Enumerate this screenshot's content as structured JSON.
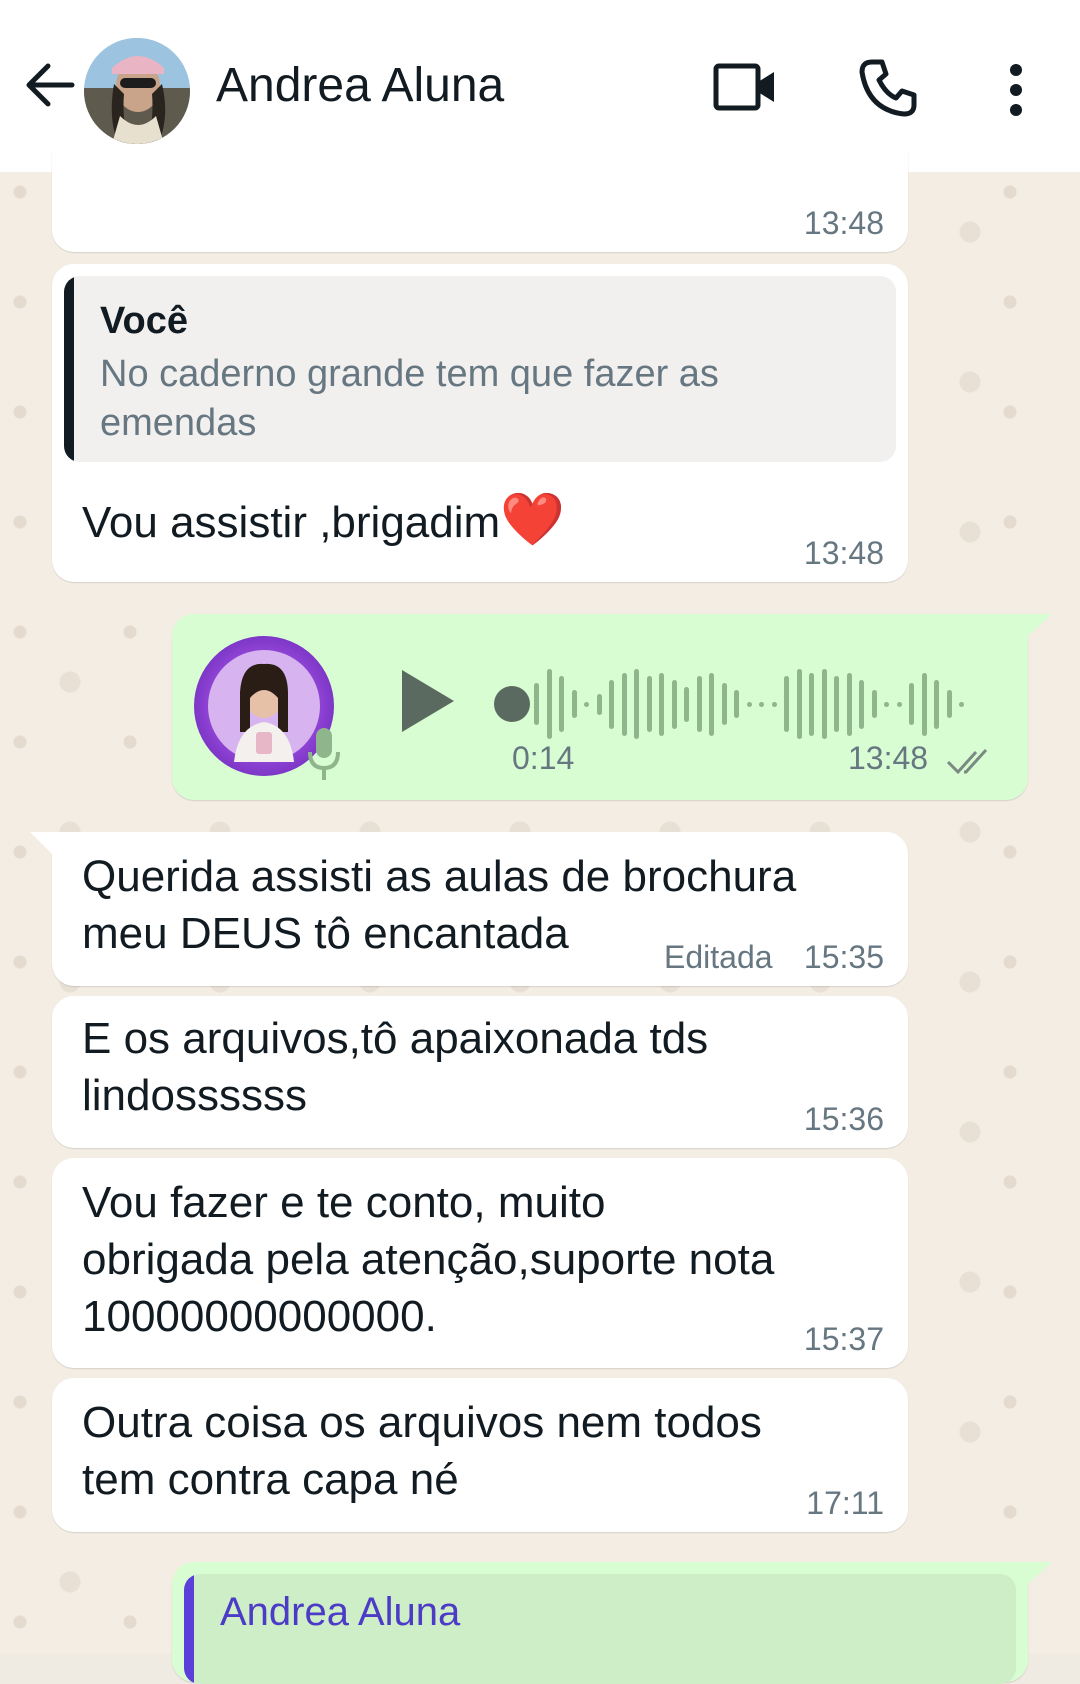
{
  "header": {
    "contact_name": "Andrea Aluna"
  },
  "icons": {
    "back": "arrow-left-icon",
    "video": "video-camera-icon",
    "call": "phone-icon",
    "menu": "more-vertical-icon",
    "mic": "microphone-icon",
    "play": "play-icon",
    "read_receipt": "double-check-icon"
  },
  "colors": {
    "header_bg": "#ffffff",
    "incoming_bubble": "#ffffff",
    "outgoing_bubble": "#d9fdd3",
    "reply_bar_own": "#111b21",
    "reply_bar_contact": "#5b3fd9",
    "reply_author_contact": "#4c3bc6",
    "waveform": "#8fb58d"
  },
  "messages": [
    {
      "id": "m0",
      "direction": "in",
      "text": "",
      "time": "13:48"
    },
    {
      "id": "m1",
      "direction": "in",
      "reply": {
        "author": "Você",
        "text": "No caderno grande tem que fazer as emendas"
      },
      "text": "Vou assistir ,brigadim",
      "emoji": "❤️",
      "time": "13:48"
    },
    {
      "id": "m2",
      "direction": "out",
      "type": "audio",
      "duration": "0:14",
      "time": "13:48",
      "progress": 0
    },
    {
      "id": "m3",
      "direction": "in",
      "text_lines": [
        "Querida assisti as aulas de brochura",
        "meu DEUS tô encantada"
      ],
      "edited_label": "Editada",
      "time": "15:35"
    },
    {
      "id": "m4",
      "direction": "in",
      "text_lines": [
        "E os arquivos,tô apaixonada tds",
        "lindossssss"
      ],
      "time": "15:36"
    },
    {
      "id": "m5",
      "direction": "in",
      "text_lines": [
        "Vou fazer e te conto, muito",
        "obrigada pela atenção,suporte nota",
        "10000000000000."
      ],
      "time": "15:37"
    },
    {
      "id": "m6",
      "direction": "in",
      "text_lines": [
        "Outra coisa os arquivos nem todos",
        "tem contra capa né"
      ],
      "time": "17:11"
    },
    {
      "id": "m7",
      "direction": "out",
      "reply": {
        "author": "Andrea Aluna"
      }
    }
  ]
}
